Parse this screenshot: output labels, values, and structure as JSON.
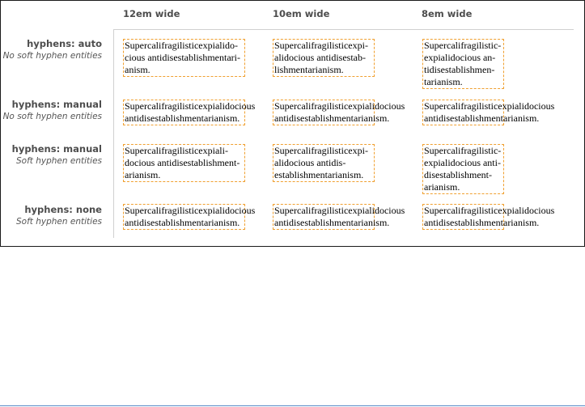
{
  "columns": [
    {
      "label": "12em wide"
    },
    {
      "label": "10em wide"
    },
    {
      "label": "8em wide"
    }
  ],
  "rows": [
    {
      "title": "hyphens: auto",
      "subtitle": "No soft hyphen entities",
      "cells": [
        [
          "Supercalifragilisticexpialido-",
          "cious antidisestablishmentari-",
          "anism."
        ],
        [
          "Supercalifragilisticexpi-",
          "alidocious antidisestab-",
          "lishmentarianism."
        ],
        [
          "Supercalifragilistic-",
          "expialidocious an-",
          "tidisestablishmen-",
          "tarianism."
        ]
      ]
    },
    {
      "title": "hyphens: manual",
      "subtitle": "No soft hyphen entities",
      "cells": [
        [
          "Supercalifragilisticexpialidocious",
          "antidisestablishmentarianism."
        ],
        [
          "Supercalifragilisticexpialidocious",
          "antidisestablishmentarianism."
        ],
        [
          "Supercalifragilisticexpialidocious",
          "antidisestablishmentarianism."
        ]
      ]
    },
    {
      "title": "hyphens: manual",
      "subtitle": "Soft hyphen entities",
      "cells": [
        [
          "Supercalifragilisticexpiali-",
          "docious antidisestablishment-",
          "arianism."
        ],
        [
          "Supercalifragilisticexpi-",
          "alidocious antidis-",
          "establishmentarianism."
        ],
        [
          "Supercalifragilistic-",
          "expialidocious anti-",
          "disestablishment-",
          "arianism."
        ]
      ]
    },
    {
      "title": "hyphens: none",
      "subtitle": "Soft hyphen entities",
      "cells": [
        [
          "Supercalifragilisticexpialidocious",
          "antidisestablishmentarianism."
        ],
        [
          "Supercalifragilisticexpialidocious",
          "antidisestablishmentarianism."
        ],
        [
          "Supercalifragilisticexpialidocious",
          "antidisestablishmentarianism."
        ]
      ]
    }
  ],
  "colors": {
    "box_border": "#f0a030",
    "label_text": "#4d4d4d",
    "divider": "#d0d0d0",
    "frame_border": "#1a1a1a"
  }
}
